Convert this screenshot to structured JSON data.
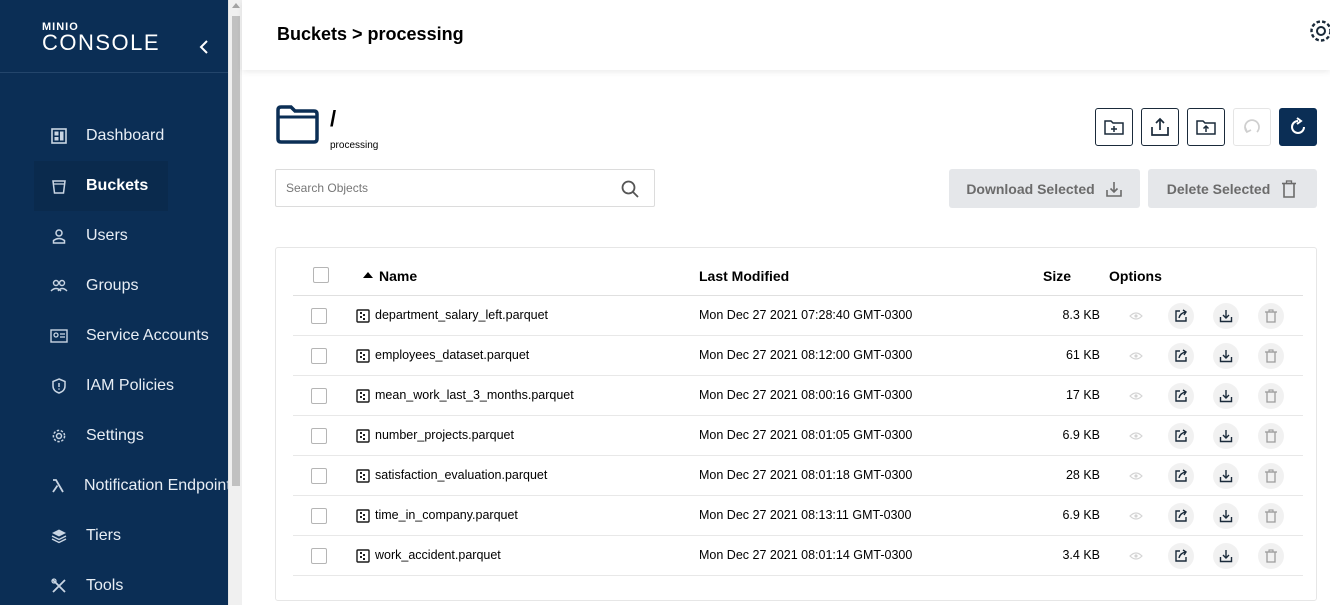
{
  "sidebar": {
    "logo": {
      "small": "MINIO",
      "big": "CONSOLE"
    },
    "items": [
      {
        "label": "Dashboard",
        "icon": "dashboard-icon",
        "active": false
      },
      {
        "label": "Buckets",
        "icon": "bucket-icon",
        "active": true
      },
      {
        "label": "Users",
        "icon": "user-icon",
        "active": false
      },
      {
        "label": "Groups",
        "icon": "groups-icon",
        "active": false
      },
      {
        "label": "Service Accounts",
        "icon": "service-accounts-icon",
        "active": false
      },
      {
        "label": "IAM Policies",
        "icon": "shield-icon",
        "active": false
      },
      {
        "label": "Settings",
        "icon": "gear-icon",
        "active": false
      },
      {
        "label": "Notification Endpoints",
        "icon": "lambda-icon",
        "active": false
      },
      {
        "label": "Tiers",
        "icon": "layers-icon",
        "active": false
      },
      {
        "label": "Tools",
        "icon": "tools-icon",
        "active": false
      }
    ]
  },
  "header": {
    "title": "Buckets > processing"
  },
  "path": {
    "slash": "/",
    "bucket": "processing"
  },
  "search": {
    "placeholder": "Search Objects",
    "value": ""
  },
  "actions": {
    "download": "Download Selected",
    "delete": "Delete Selected"
  },
  "table": {
    "columns": {
      "name": "Name",
      "modified": "Last Modified",
      "size": "Size",
      "options": "Options"
    },
    "rows": [
      {
        "name": "department_salary_left.parquet",
        "modified": "Mon Dec 27 2021 07:28:40 GMT-0300",
        "size": "8.3 KB"
      },
      {
        "name": "employees_dataset.parquet",
        "modified": "Mon Dec 27 2021 08:12:00 GMT-0300",
        "size": "61 KB"
      },
      {
        "name": "mean_work_last_3_months.parquet",
        "modified": "Mon Dec 27 2021 08:00:16 GMT-0300",
        "size": "17 KB"
      },
      {
        "name": "number_projects.parquet",
        "modified": "Mon Dec 27 2021 08:01:05 GMT-0300",
        "size": "6.9 KB"
      },
      {
        "name": "satisfaction_evaluation.parquet",
        "modified": "Mon Dec 27 2021 08:01:18 GMT-0300",
        "size": "28 KB"
      },
      {
        "name": "time_in_company.parquet",
        "modified": "Mon Dec 27 2021 08:13:11 GMT-0300",
        "size": "6.9 KB"
      },
      {
        "name": "work_accident.parquet",
        "modified": "Mon Dec 27 2021 08:01:14 GMT-0300",
        "size": "3.4 KB"
      }
    ]
  },
  "colors": {
    "sidebar": "#0b2e55",
    "accent": "#0b2e55",
    "disabled": "#e5e7ea"
  }
}
